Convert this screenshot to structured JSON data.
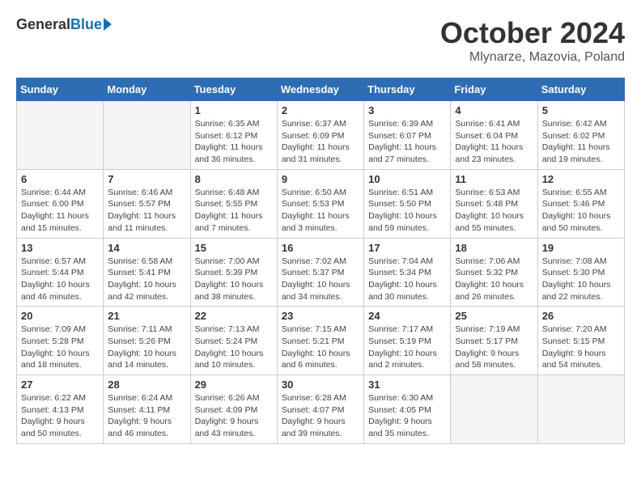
{
  "header": {
    "logo_general": "General",
    "logo_blue": "Blue",
    "month_title": "October 2024",
    "location": "Mlynarze, Mazovia, Poland"
  },
  "days_of_week": [
    "Sunday",
    "Monday",
    "Tuesday",
    "Wednesday",
    "Thursday",
    "Friday",
    "Saturday"
  ],
  "weeks": [
    [
      {
        "day": "",
        "empty": true
      },
      {
        "day": "",
        "empty": true
      },
      {
        "day": "1",
        "sunrise": "Sunrise: 6:35 AM",
        "sunset": "Sunset: 6:12 PM",
        "daylight": "Daylight: 11 hours and 36 minutes."
      },
      {
        "day": "2",
        "sunrise": "Sunrise: 6:37 AM",
        "sunset": "Sunset: 6:09 PM",
        "daylight": "Daylight: 11 hours and 31 minutes."
      },
      {
        "day": "3",
        "sunrise": "Sunrise: 6:39 AM",
        "sunset": "Sunset: 6:07 PM",
        "daylight": "Daylight: 11 hours and 27 minutes."
      },
      {
        "day": "4",
        "sunrise": "Sunrise: 6:41 AM",
        "sunset": "Sunset: 6:04 PM",
        "daylight": "Daylight: 11 hours and 23 minutes."
      },
      {
        "day": "5",
        "sunrise": "Sunrise: 6:42 AM",
        "sunset": "Sunset: 6:02 PM",
        "daylight": "Daylight: 11 hours and 19 minutes."
      }
    ],
    [
      {
        "day": "6",
        "sunrise": "Sunrise: 6:44 AM",
        "sunset": "Sunset: 6:00 PM",
        "daylight": "Daylight: 11 hours and 15 minutes."
      },
      {
        "day": "7",
        "sunrise": "Sunrise: 6:46 AM",
        "sunset": "Sunset: 5:57 PM",
        "daylight": "Daylight: 11 hours and 11 minutes."
      },
      {
        "day": "8",
        "sunrise": "Sunrise: 6:48 AM",
        "sunset": "Sunset: 5:55 PM",
        "daylight": "Daylight: 11 hours and 7 minutes."
      },
      {
        "day": "9",
        "sunrise": "Sunrise: 6:50 AM",
        "sunset": "Sunset: 5:53 PM",
        "daylight": "Daylight: 11 hours and 3 minutes."
      },
      {
        "day": "10",
        "sunrise": "Sunrise: 6:51 AM",
        "sunset": "Sunset: 5:50 PM",
        "daylight": "Daylight: 10 hours and 59 minutes."
      },
      {
        "day": "11",
        "sunrise": "Sunrise: 6:53 AM",
        "sunset": "Sunset: 5:48 PM",
        "daylight": "Daylight: 10 hours and 55 minutes."
      },
      {
        "day": "12",
        "sunrise": "Sunrise: 6:55 AM",
        "sunset": "Sunset: 5:46 PM",
        "daylight": "Daylight: 10 hours and 50 minutes."
      }
    ],
    [
      {
        "day": "13",
        "sunrise": "Sunrise: 6:57 AM",
        "sunset": "Sunset: 5:44 PM",
        "daylight": "Daylight: 10 hours and 46 minutes."
      },
      {
        "day": "14",
        "sunrise": "Sunrise: 6:58 AM",
        "sunset": "Sunset: 5:41 PM",
        "daylight": "Daylight: 10 hours and 42 minutes."
      },
      {
        "day": "15",
        "sunrise": "Sunrise: 7:00 AM",
        "sunset": "Sunset: 5:39 PM",
        "daylight": "Daylight: 10 hours and 38 minutes."
      },
      {
        "day": "16",
        "sunrise": "Sunrise: 7:02 AM",
        "sunset": "Sunset: 5:37 PM",
        "daylight": "Daylight: 10 hours and 34 minutes."
      },
      {
        "day": "17",
        "sunrise": "Sunrise: 7:04 AM",
        "sunset": "Sunset: 5:34 PM",
        "daylight": "Daylight: 10 hours and 30 minutes."
      },
      {
        "day": "18",
        "sunrise": "Sunrise: 7:06 AM",
        "sunset": "Sunset: 5:32 PM",
        "daylight": "Daylight: 10 hours and 26 minutes."
      },
      {
        "day": "19",
        "sunrise": "Sunrise: 7:08 AM",
        "sunset": "Sunset: 5:30 PM",
        "daylight": "Daylight: 10 hours and 22 minutes."
      }
    ],
    [
      {
        "day": "20",
        "sunrise": "Sunrise: 7:09 AM",
        "sunset": "Sunset: 5:28 PM",
        "daylight": "Daylight: 10 hours and 18 minutes."
      },
      {
        "day": "21",
        "sunrise": "Sunrise: 7:11 AM",
        "sunset": "Sunset: 5:26 PM",
        "daylight": "Daylight: 10 hours and 14 minutes."
      },
      {
        "day": "22",
        "sunrise": "Sunrise: 7:13 AM",
        "sunset": "Sunset: 5:24 PM",
        "daylight": "Daylight: 10 hours and 10 minutes."
      },
      {
        "day": "23",
        "sunrise": "Sunrise: 7:15 AM",
        "sunset": "Sunset: 5:21 PM",
        "daylight": "Daylight: 10 hours and 6 minutes."
      },
      {
        "day": "24",
        "sunrise": "Sunrise: 7:17 AM",
        "sunset": "Sunset: 5:19 PM",
        "daylight": "Daylight: 10 hours and 2 minutes."
      },
      {
        "day": "25",
        "sunrise": "Sunrise: 7:19 AM",
        "sunset": "Sunset: 5:17 PM",
        "daylight": "Daylight: 9 hours and 58 minutes."
      },
      {
        "day": "26",
        "sunrise": "Sunrise: 7:20 AM",
        "sunset": "Sunset: 5:15 PM",
        "daylight": "Daylight: 9 hours and 54 minutes."
      }
    ],
    [
      {
        "day": "27",
        "sunrise": "Sunrise: 6:22 AM",
        "sunset": "Sunset: 4:13 PM",
        "daylight": "Daylight: 9 hours and 50 minutes."
      },
      {
        "day": "28",
        "sunrise": "Sunrise: 6:24 AM",
        "sunset": "Sunset: 4:11 PM",
        "daylight": "Daylight: 9 hours and 46 minutes."
      },
      {
        "day": "29",
        "sunrise": "Sunrise: 6:26 AM",
        "sunset": "Sunset: 4:09 PM",
        "daylight": "Daylight: 9 hours and 43 minutes."
      },
      {
        "day": "30",
        "sunrise": "Sunrise: 6:28 AM",
        "sunset": "Sunset: 4:07 PM",
        "daylight": "Daylight: 9 hours and 39 minutes."
      },
      {
        "day": "31",
        "sunrise": "Sunrise: 6:30 AM",
        "sunset": "Sunset: 4:05 PM",
        "daylight": "Daylight: 9 hours and 35 minutes."
      },
      {
        "day": "",
        "empty": true
      },
      {
        "day": "",
        "empty": true
      }
    ]
  ]
}
